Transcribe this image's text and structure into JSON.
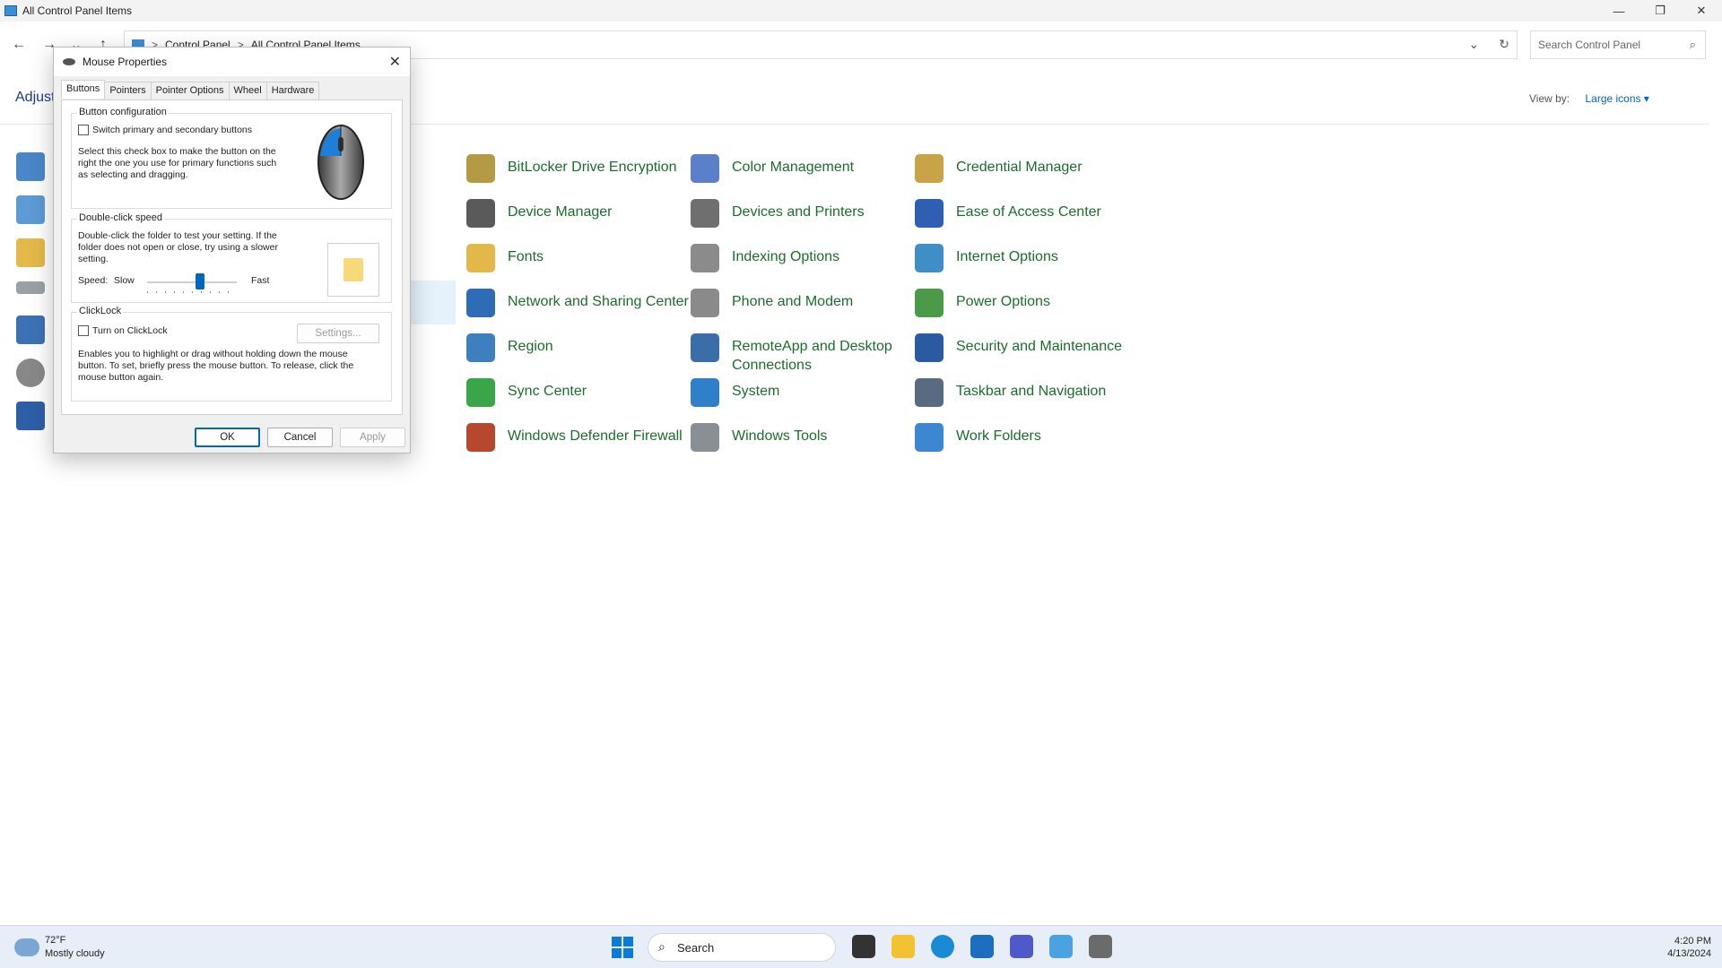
{
  "window": {
    "title": "All Control Panel Items",
    "min": "—",
    "max": "❐",
    "close": "✕"
  },
  "nav": {
    "back": "←",
    "forward": "→",
    "recent": "⌄",
    "up": "↑",
    "breadcrumb": [
      "Control Panel",
      "All Control Panel Items"
    ],
    "sep": ">",
    "dropdown": "⌄",
    "refresh": "↻",
    "search_placeholder": "Search Control Panel",
    "search_icon": "⌕"
  },
  "header": {
    "title": "Adjust",
    "view_by_label": "View by:",
    "view_by_value": "Large icons ▾"
  },
  "items": [
    {
      "label": "BitLocker Drive Encryption",
      "icon": "bitlocker-icon",
      "color": "#b59a45"
    },
    {
      "label": "Color Management",
      "icon": "color-management-icon",
      "color": "#5b7fc8"
    },
    {
      "label": "Credential Manager",
      "icon": "credential-manager-icon",
      "color": "#c9a348"
    },
    {
      "label": "Device Manager",
      "icon": "device-manager-icon",
      "color": "#5a5a5a"
    },
    {
      "label": "Devices and Printers",
      "icon": "devices-printers-icon",
      "color": "#6f6f6f"
    },
    {
      "label": "Ease of Access Center",
      "icon": "ease-of-access-icon",
      "color": "#2f5fb3"
    },
    {
      "label": "Fonts",
      "icon": "fonts-icon",
      "color": "#e2b84a"
    },
    {
      "label": "Indexing Options",
      "icon": "indexing-icon",
      "color": "#8b8b8b"
    },
    {
      "label": "Internet Options",
      "icon": "internet-options-icon",
      "color": "#3f8fc6"
    },
    {
      "label": "Network and Sharing Center",
      "icon": "network-icon",
      "color": "#2e6db5"
    },
    {
      "label": "Phone and Modem",
      "icon": "phone-modem-icon",
      "color": "#8a8a8a"
    },
    {
      "label": "Power Options",
      "icon": "power-icon",
      "color": "#4a9a4a"
    },
    {
      "label": "Region",
      "icon": "region-icon",
      "color": "#3d7fbf"
    },
    {
      "label": "RemoteApp and Desktop Connections",
      "icon": "remoteapp-icon",
      "color": "#3b6ea8"
    },
    {
      "label": "Security and Maintenance",
      "icon": "security-flag-icon",
      "color": "#2c5aa0"
    },
    {
      "label": "Sync Center",
      "icon": "sync-icon",
      "color": "#3aa64a"
    },
    {
      "label": "System",
      "icon": "system-icon",
      "color": "#2f7fc9"
    },
    {
      "label": "Taskbar and Navigation",
      "icon": "taskbar-icon",
      "color": "#5a6a80"
    },
    {
      "label": "Windows Defender Firewall",
      "icon": "firewall-icon",
      "color": "#b5482e"
    },
    {
      "label": "Windows Tools",
      "icon": "windows-tools-icon",
      "color": "#8a8f96"
    },
    {
      "label": "Work Folders",
      "icon": "work-folders-icon",
      "color": "#3d86d0"
    }
  ],
  "dialog": {
    "title": "Mouse Properties",
    "close": "✕",
    "tabs": [
      "Buttons",
      "Pointers",
      "Pointer Options",
      "Wheel",
      "Hardware"
    ],
    "button_config": {
      "label": "Button configuration",
      "checkbox": "Switch primary and secondary buttons",
      "desc": "Select this check box to make the button on the right the one you use for primary functions such as selecting and dragging."
    },
    "double_click": {
      "label": "Double-click speed",
      "desc": "Double-click the folder to test your setting. If the folder does not open or close, try using a slower setting.",
      "speed": "Speed:",
      "slow": "Slow",
      "fast": "Fast",
      "value": 0.6
    },
    "clicklock": {
      "label": "ClickLock",
      "checkbox": "Turn on ClickLock",
      "settings": "Settings...",
      "desc": "Enables you to highlight or drag without holding down the mouse button. To set, briefly press the mouse button. To release, click the mouse button again."
    },
    "ok": "OK",
    "cancel": "Cancel",
    "apply": "Apply"
  },
  "taskbar": {
    "temp": "72°F",
    "weather": "Mostly cloudy",
    "search": "Search",
    "time": "4:20 PM",
    "date": "4/13/2024"
  }
}
